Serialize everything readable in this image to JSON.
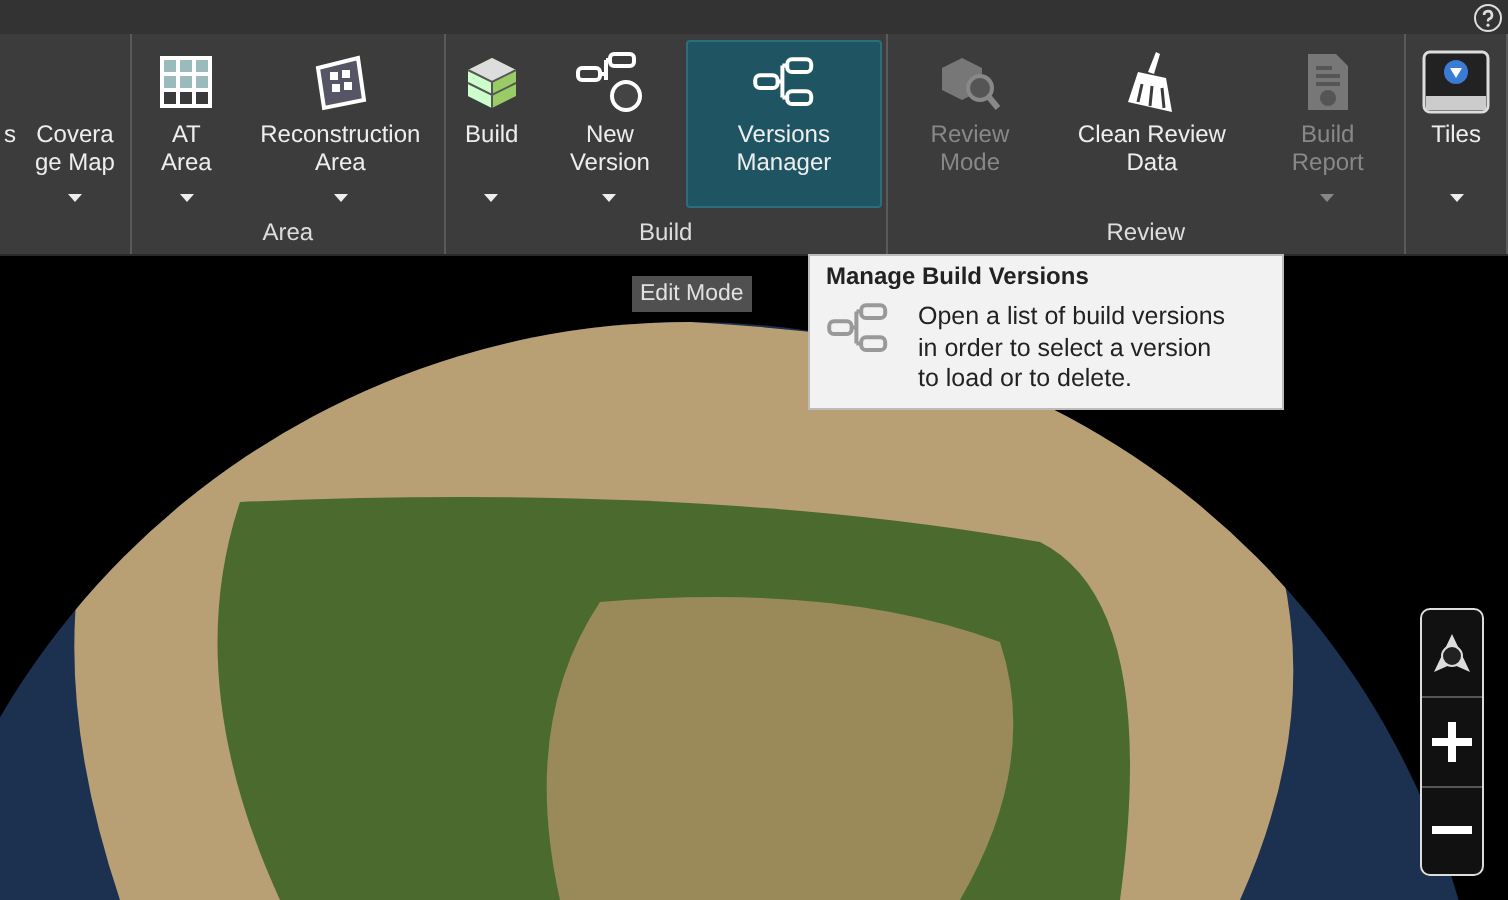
{
  "ribbon": {
    "groups": [
      {
        "buttons": [
          {
            "label": "s",
            "caret": false,
            "disabled": false,
            "selected": false
          },
          {
            "label": "Coverage Map",
            "caret": true,
            "disabled": false,
            "selected": false
          }
        ]
      },
      {
        "label": "Area",
        "buttons": [
          {
            "label": "AT Area",
            "caret": true,
            "disabled": false,
            "selected": false
          },
          {
            "label": "Reconstruction Area",
            "caret": true,
            "disabled": false,
            "selected": false
          }
        ]
      },
      {
        "label": "Build",
        "buttons": [
          {
            "label": "Build",
            "caret": true,
            "disabled": false,
            "selected": false
          },
          {
            "label": "New Version",
            "caret": true,
            "disabled": false,
            "selected": false
          },
          {
            "label": "Versions Manager",
            "caret": false,
            "disabled": false,
            "selected": true
          }
        ]
      },
      {
        "label": "Review",
        "buttons": [
          {
            "label": "Review Mode",
            "caret": false,
            "disabled": true,
            "selected": false
          },
          {
            "label": "Clean Review Data",
            "caret": false,
            "disabled": false,
            "selected": false
          },
          {
            "label": "Build Report",
            "caret": true,
            "disabled": true,
            "selected": false
          }
        ]
      },
      {
        "buttons": [
          {
            "label": "Tiles",
            "caret": true,
            "disabled": false,
            "selected": false
          }
        ]
      }
    ]
  },
  "map": {
    "mode_label": "Edit Mode"
  },
  "tooltip": {
    "title": "Manage Build Versions",
    "text": "Open a list of build versions in order to select a version to load or to delete."
  }
}
